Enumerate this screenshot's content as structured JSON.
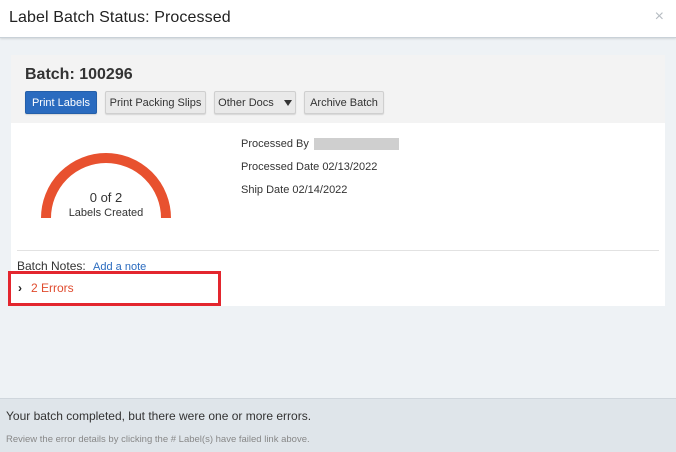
{
  "modal": {
    "title": "Label Batch Status: Processed",
    "close_icon": "×"
  },
  "batch": {
    "title": "Batch: 100296",
    "buttons": {
      "print_labels": "Print Labels",
      "print_packing_slips": "Print Packing Slips",
      "other_docs": "Other Docs",
      "archive_batch": "Archive Batch"
    }
  },
  "gauge": {
    "value_text": "0 of 2",
    "label": "Labels Created",
    "created": 0,
    "total": 2,
    "color": "#e8512f"
  },
  "details": {
    "processed_by_label": "Processed By",
    "processed_date": "Processed Date 02/13/2022",
    "ship_date": "Ship Date 02/14/2022"
  },
  "notes": {
    "label": "Batch Notes:",
    "add_note_link": "Add a note"
  },
  "errors": {
    "toggle_icon": "chevron-right-icon",
    "text": "2 Errors"
  },
  "footer": {
    "message": "Your batch completed, but there were one or more errors.",
    "sub_message": "Review the error details by clicking the # Label(s) have failed link above."
  },
  "colors": {
    "primary_button": "#2a6bbf",
    "error_text": "#e04b2e",
    "highlight_box": "#e3262e"
  }
}
